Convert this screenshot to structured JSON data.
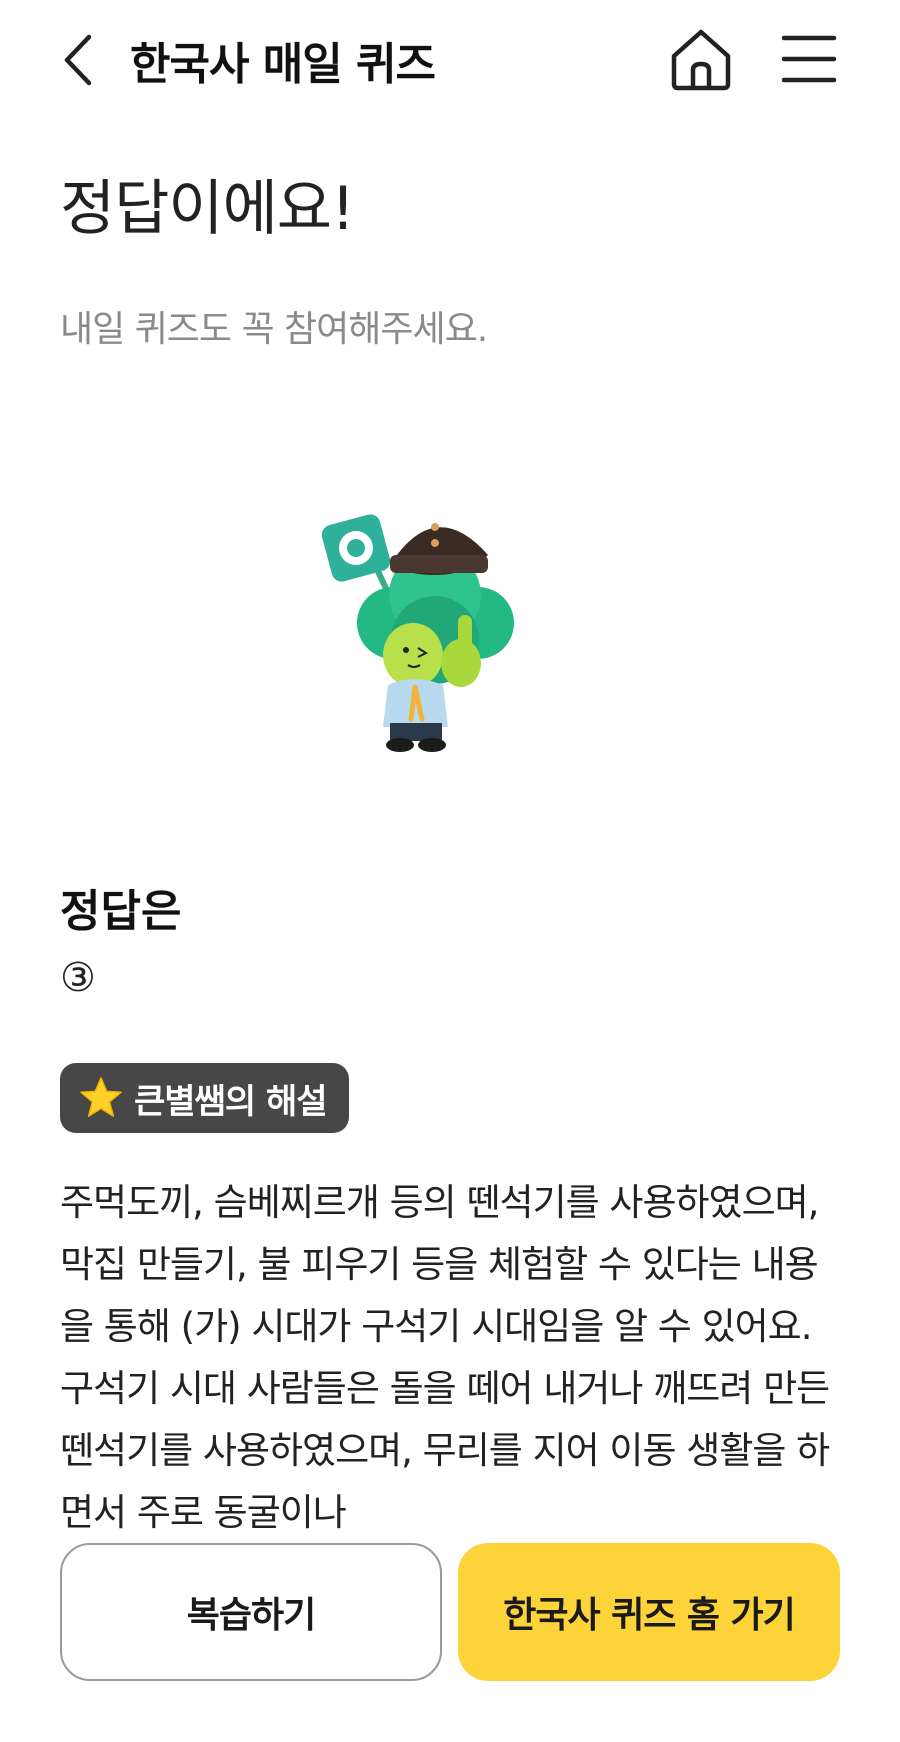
{
  "header": {
    "title": "한국사 매일 퀴즈"
  },
  "result": {
    "title": "정답이에요!",
    "subtitle": "내일 퀴즈도 꼭 참여해주세요."
  },
  "answer": {
    "label": "정답은",
    "value": "③"
  },
  "explanation": {
    "badge_label": "큰별쌤의 해설",
    "text": "주먹도끼, 슴베찌르개 등의 뗀석기를 사용하였으며, 막집 만들기, 불 피우기 등을 체험할 수 있다는 내용을 통해 (가) 시대가 구석기 시대임을 알 수 있어요. 구석기 시대 사람들은 돌을 떼어 내거나 깨뜨려 만든 뗀석기를 사용하였으며, 무리를 지어 이동 생활을 하면서 주로 동굴이나"
  },
  "buttons": {
    "review": "복습하기",
    "quiz_home": "한국사 퀴즈 홈 가기"
  },
  "colors": {
    "accent_yellow": "#fdd33a",
    "badge_bg": "#474747",
    "mascot_green": "#2fc48f"
  }
}
